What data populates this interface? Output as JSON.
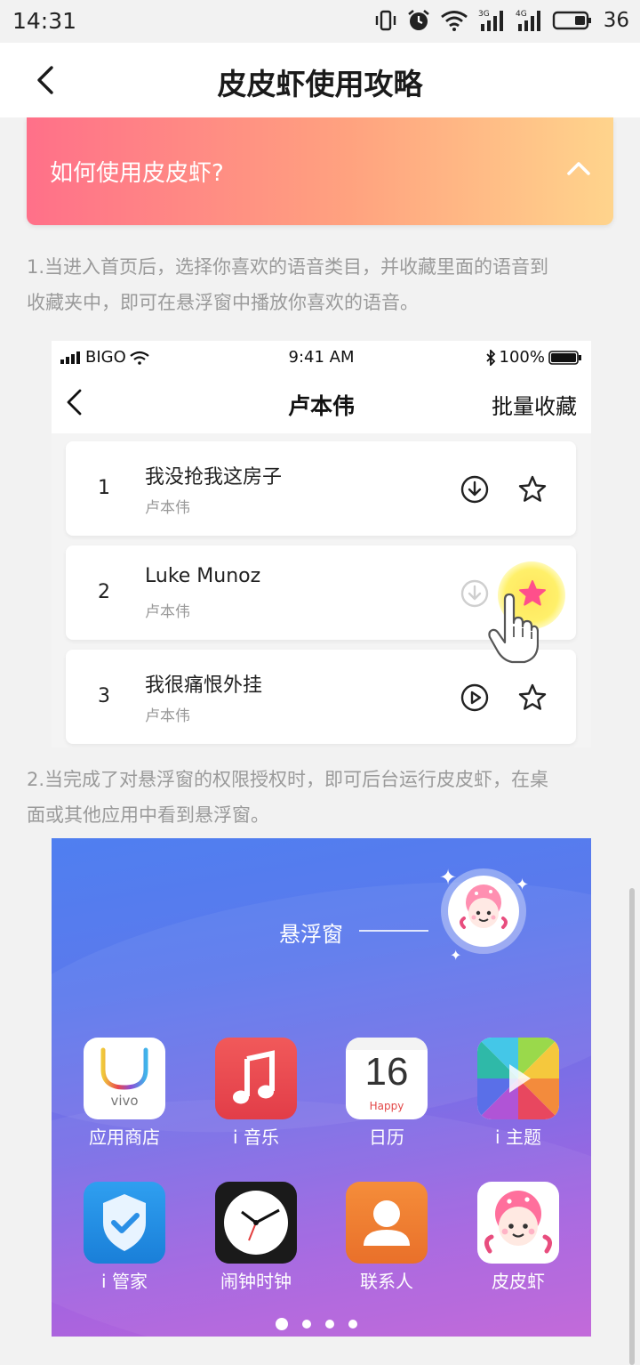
{
  "status_bar": {
    "time": "14:31",
    "battery_level": "36",
    "net1": "3G",
    "net2": "4G"
  },
  "nav": {
    "title": "皮皮虾使用攻略"
  },
  "accordion": {
    "title": "如何使用皮皮虾?"
  },
  "paragraphs": {
    "p1_line1": "1.当进入首页后，选择你喜欢的语音类目，并收藏里面的语音到",
    "p1_line2": "收藏夹中，即可在悬浮窗中播放你喜欢的语音。",
    "p2_line1": "2.当完成了对悬浮窗的权限授权时，即可后台运行皮皮虾，在桌",
    "p2_line2": "面或其他应用中看到悬浮窗。"
  },
  "shot1": {
    "carrier": "BIGO",
    "time": "9:41 AM",
    "battery": "100%",
    "title": "卢本伟",
    "action": "批量收藏",
    "songs": [
      {
        "num": "1",
        "name": "我没抢我这房子",
        "artist": "卢本伟"
      },
      {
        "num": "2",
        "name": "Luke Munoz",
        "artist": "卢本伟"
      },
      {
        "num": "3",
        "name": "我很痛恨外挂",
        "artist": "卢本伟"
      }
    ]
  },
  "shot2": {
    "float_label": "悬浮窗",
    "apps": [
      {
        "label": "应用商店",
        "icon": "vivo-store-icon"
      },
      {
        "label": "i 音乐",
        "icon": "music-icon"
      },
      {
        "label": "日历",
        "icon": "calendar-icon",
        "day": "16",
        "sub": "Happy"
      },
      {
        "label": "i 主题",
        "icon": "theme-icon"
      },
      {
        "label": "i 管家",
        "icon": "shield-icon"
      },
      {
        "label": "闹钟时钟",
        "icon": "clock-icon"
      },
      {
        "label": "联系人",
        "icon": "contacts-icon"
      },
      {
        "label": "皮皮虾",
        "icon": "pipixia-icon"
      }
    ],
    "vivo_text": "vivo"
  },
  "colors": {
    "accordion_start": "#ff7089",
    "accordion_end": "#ffd48c",
    "text_gray": "#9a9a9a",
    "star_pink": "#ff4f8b"
  }
}
